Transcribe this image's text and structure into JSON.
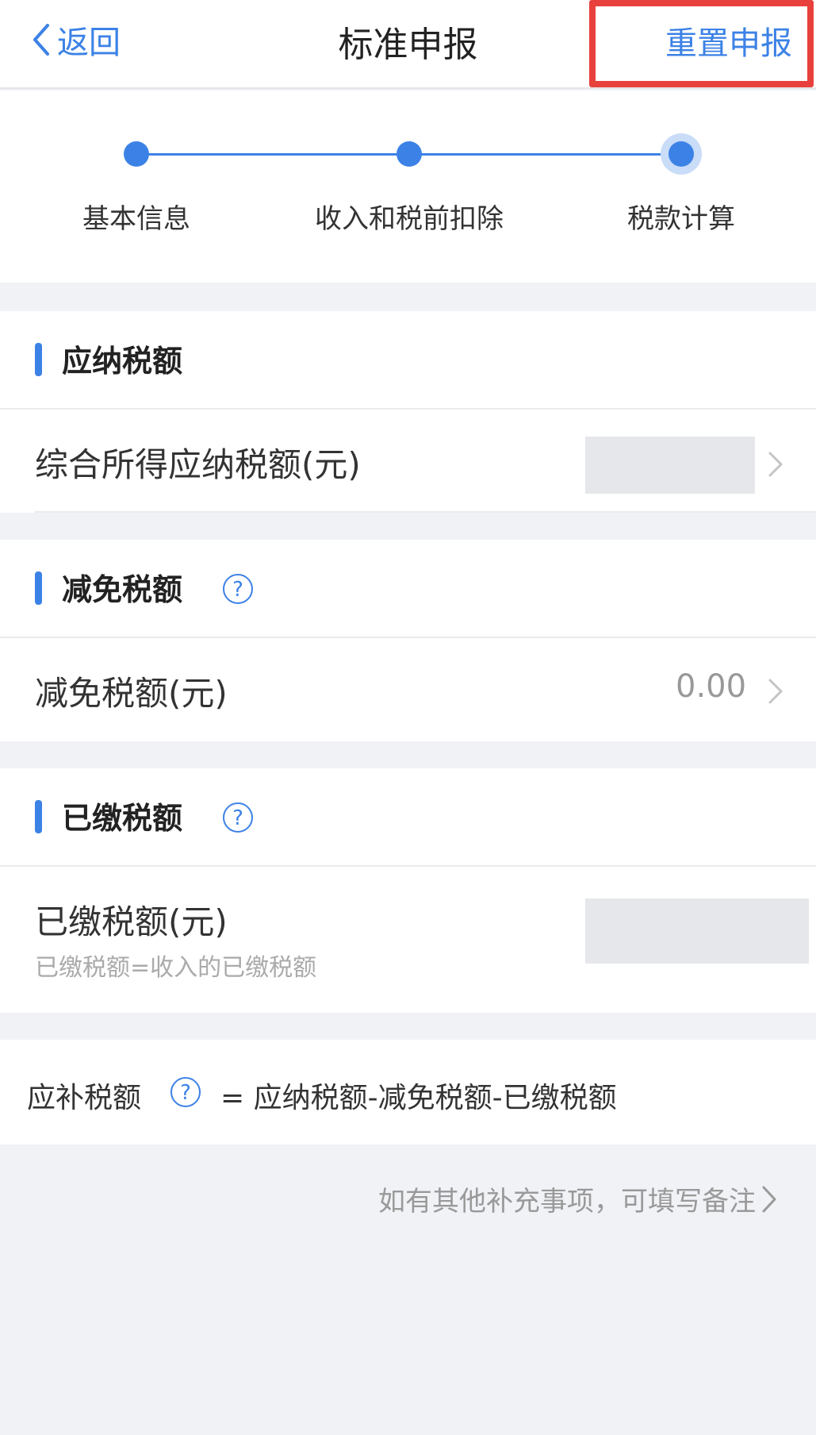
{
  "header": {
    "back_label": "返回",
    "title": "标准申报",
    "reset_label": "重置申报"
  },
  "steps": [
    {
      "label": "基本信息"
    },
    {
      "label": "收入和税前扣除"
    },
    {
      "label": "税款计算"
    }
  ],
  "accent_color": "#3c82e6",
  "highlight_color": "#e8413d",
  "sections": {
    "taxable": {
      "title": "应纳税额",
      "row_label": "综合所得应纳税额(元)",
      "row_value": ""
    },
    "reduction": {
      "title": "减免税额",
      "row_label": "减免税额(元)",
      "row_value": "0.00"
    },
    "paid": {
      "title": "已缴税额",
      "row_label": "已缴税额(元)",
      "row_sub": "已缴税额=收入的已缴税额",
      "row_value": ""
    }
  },
  "formula": {
    "label": "应补税额",
    "expression": "= 应纳税额-减免税额-已缴税额"
  },
  "remark": {
    "label": "如有其他补充事项，可填写备注"
  }
}
